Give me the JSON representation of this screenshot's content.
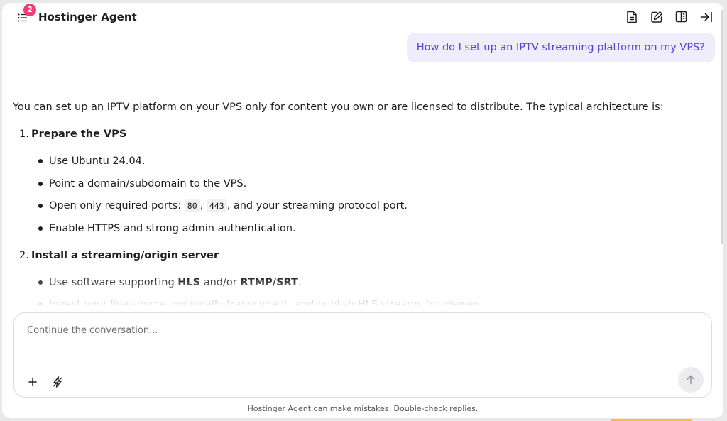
{
  "header": {
    "title": "Hostinger Agent",
    "notification_count": "2"
  },
  "user_message": "How do I set up an IPTV streaming platform on my VPS?",
  "response": {
    "intro": "You can set up an IPTV platform on your VPS only for content you own or are licensed to distribute. The typical architecture is:",
    "steps": [
      {
        "number": "1.",
        "title": "Prepare the VPS",
        "bullets": [
          {
            "text": "Use Ubuntu 24.04."
          },
          {
            "text": "Point a domain/subdomain to the VPS."
          },
          {
            "pre": "Open only required ports: ",
            "code1": "80",
            "sep": ", ",
            "code2": "443",
            "post": ", and your streaming protocol port."
          },
          {
            "text": "Enable HTTPS and strong admin authentication."
          }
        ]
      },
      {
        "number": "2.",
        "title": "Install a streaming/origin server",
        "bullets": [
          {
            "pre": "Use software supporting ",
            "bold1": "HLS",
            "mid": " and/or ",
            "bold2": "RTMP/SRT",
            "post": "."
          },
          {
            "text": "Ingest your live source, optionally transcode it, and publish HLS streams for viewers."
          }
        ]
      }
    ]
  },
  "composer": {
    "placeholder": "Continue the conversation..."
  },
  "disclaimer": "Hostinger Agent can make mistakes. Double-check replies.",
  "icons": {
    "menu": "list-icon",
    "doc": "document-icon",
    "edit": "edit-icon",
    "panel": "book-panel-icon",
    "collapse": "collapse-right-icon",
    "add": "plus-icon",
    "zap": "zap-icon",
    "send": "arrow-up-icon"
  },
  "colors": {
    "accent": "#5b3fd6",
    "user_bubble": "#efedfc",
    "badge": "#f03e7a"
  }
}
